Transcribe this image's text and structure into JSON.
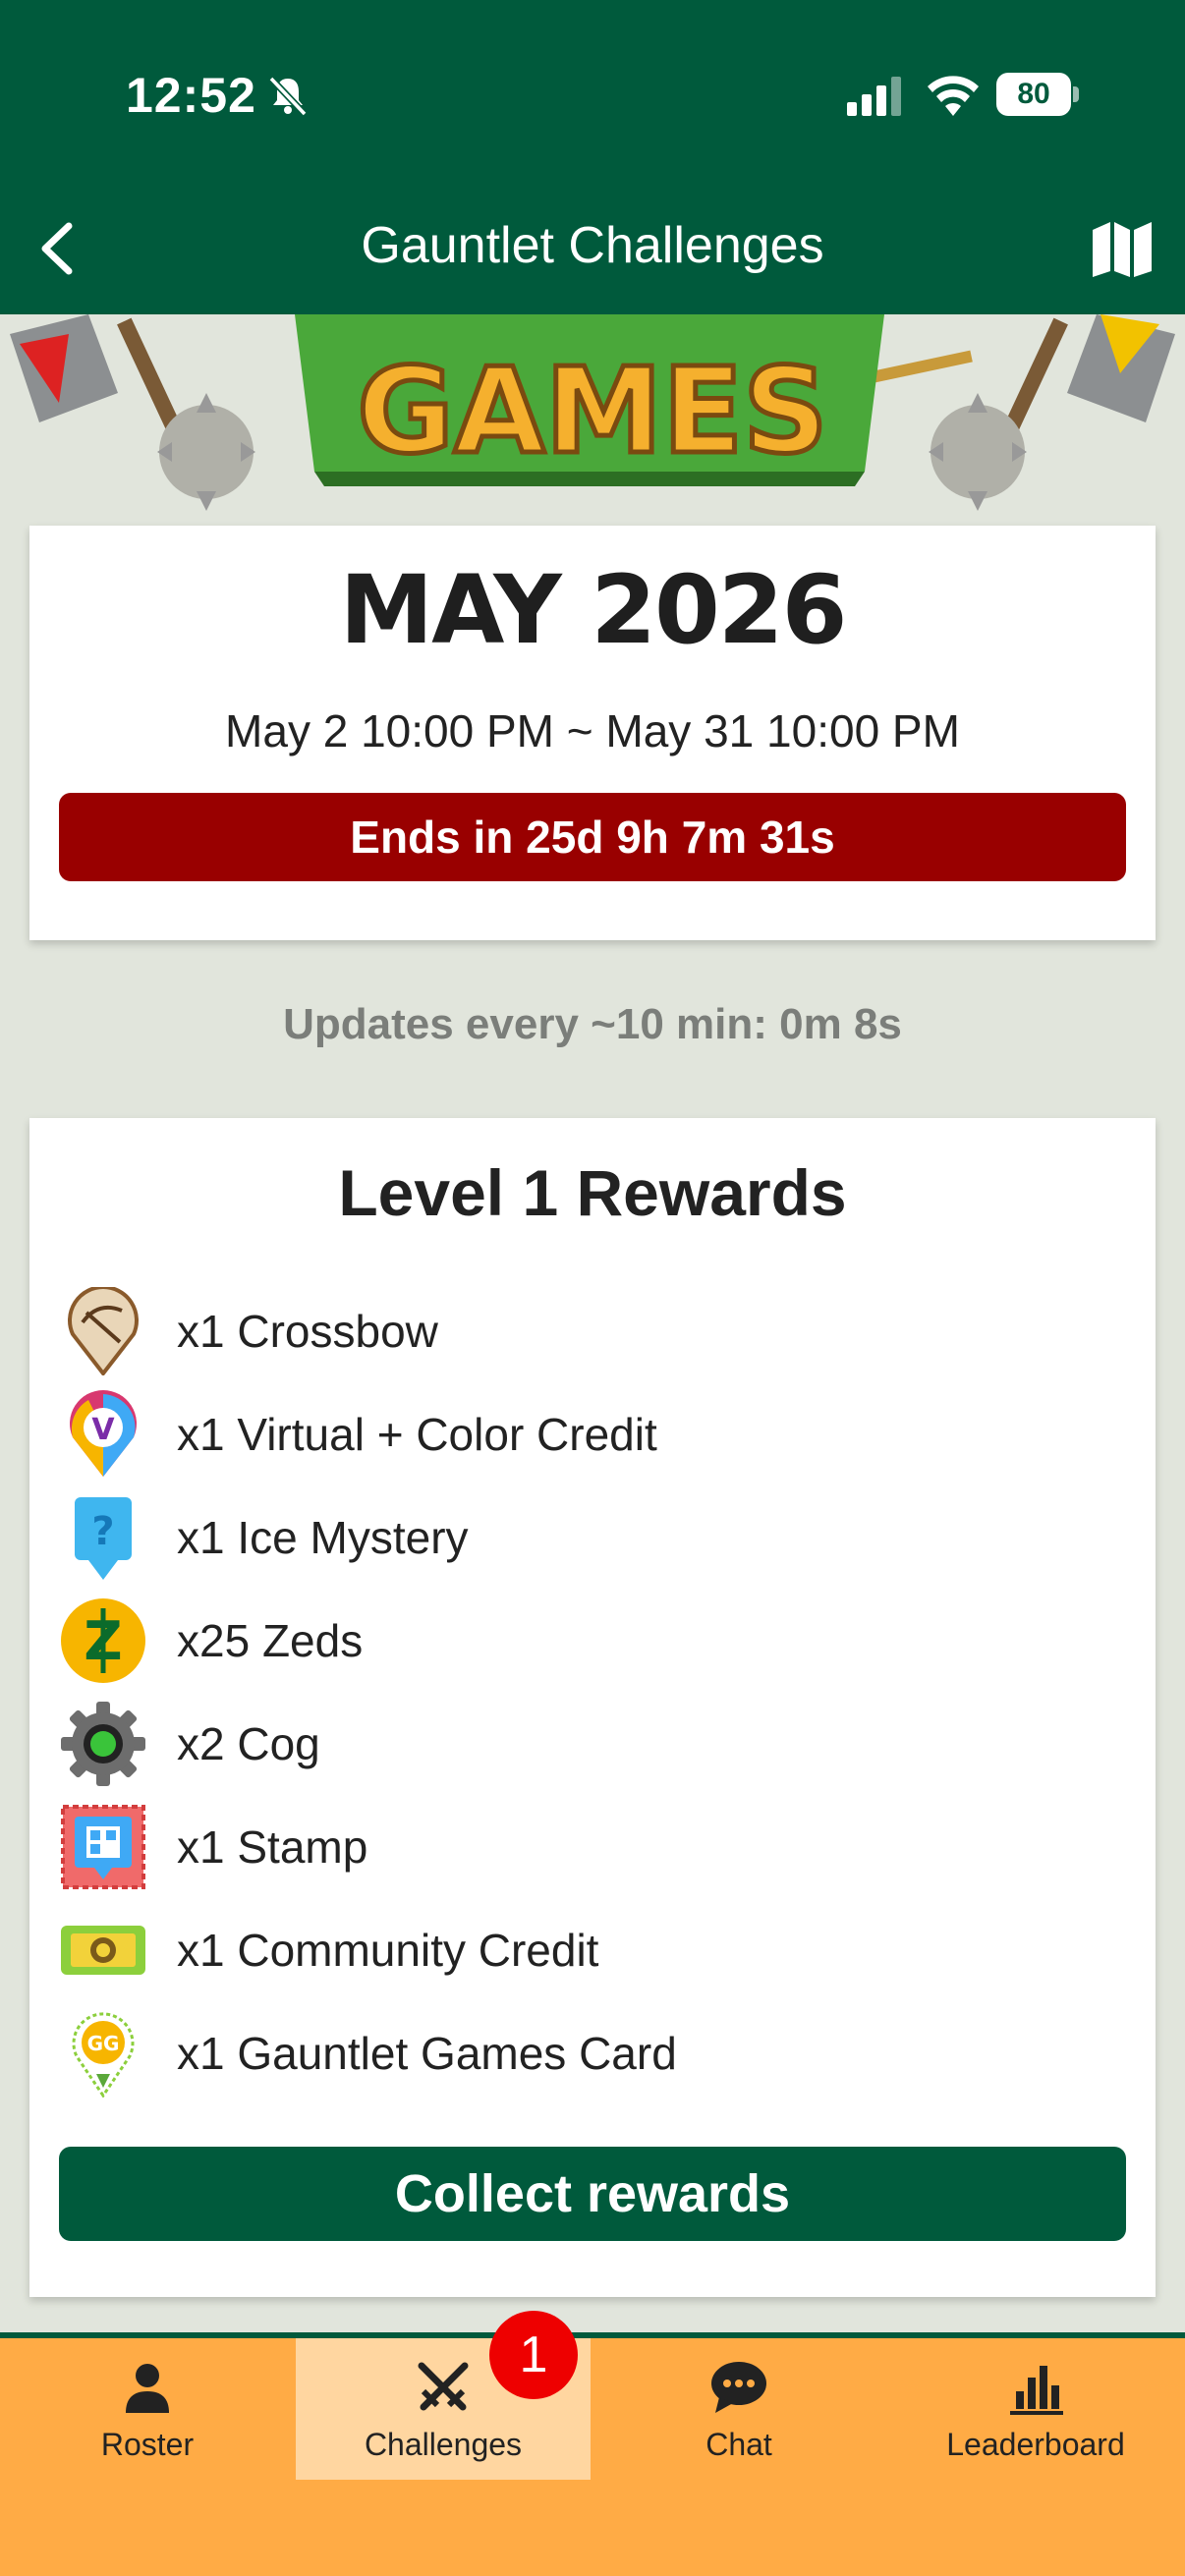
{
  "status_bar": {
    "time": "12:52",
    "battery": "80"
  },
  "nav": {
    "title": "Gauntlet Challenges"
  },
  "banner": {
    "text": "GAMES"
  },
  "month_card": {
    "month": "MAY 2026",
    "range": "May 2 10:00 PM ~ May 31 10:00 PM",
    "countdown": "Ends in 25d 9h 7m 31s"
  },
  "updates_text": "Updates every ~10 min: 0m 8s",
  "rewards": {
    "title": "Level 1 Rewards",
    "items": [
      {
        "label": "x1 Crossbow",
        "icon": "crossbow-icon"
      },
      {
        "label": "x1 Virtual + Color Credit",
        "icon": "virtual-color-credit-icon"
      },
      {
        "label": "x1 Ice Mystery",
        "icon": "ice-mystery-icon"
      },
      {
        "label": "x25 Zeds",
        "icon": "zeds-icon"
      },
      {
        "label": "x2 Cog",
        "icon": "cog-icon"
      },
      {
        "label": "x1 Stamp",
        "icon": "stamp-icon"
      },
      {
        "label": "x1 Community Credit",
        "icon": "community-credit-icon"
      },
      {
        "label": "x1 Gauntlet Games Card",
        "icon": "gauntlet-games-card-icon"
      }
    ],
    "collect_label": "Collect rewards"
  },
  "tabs": [
    {
      "label": "Roster",
      "icon": "person-icon"
    },
    {
      "label": "Challenges",
      "icon": "crossed-swords-icon",
      "badge": "1",
      "active": true
    },
    {
      "label": "Chat",
      "icon": "chat-bubble-icon"
    },
    {
      "label": "Leaderboard",
      "icon": "bar-chart-icon"
    }
  ],
  "colors": {
    "primary": "#005a3c",
    "countdown": "#990000",
    "tabbar": "#ffab45",
    "badge": "#ee0000"
  }
}
